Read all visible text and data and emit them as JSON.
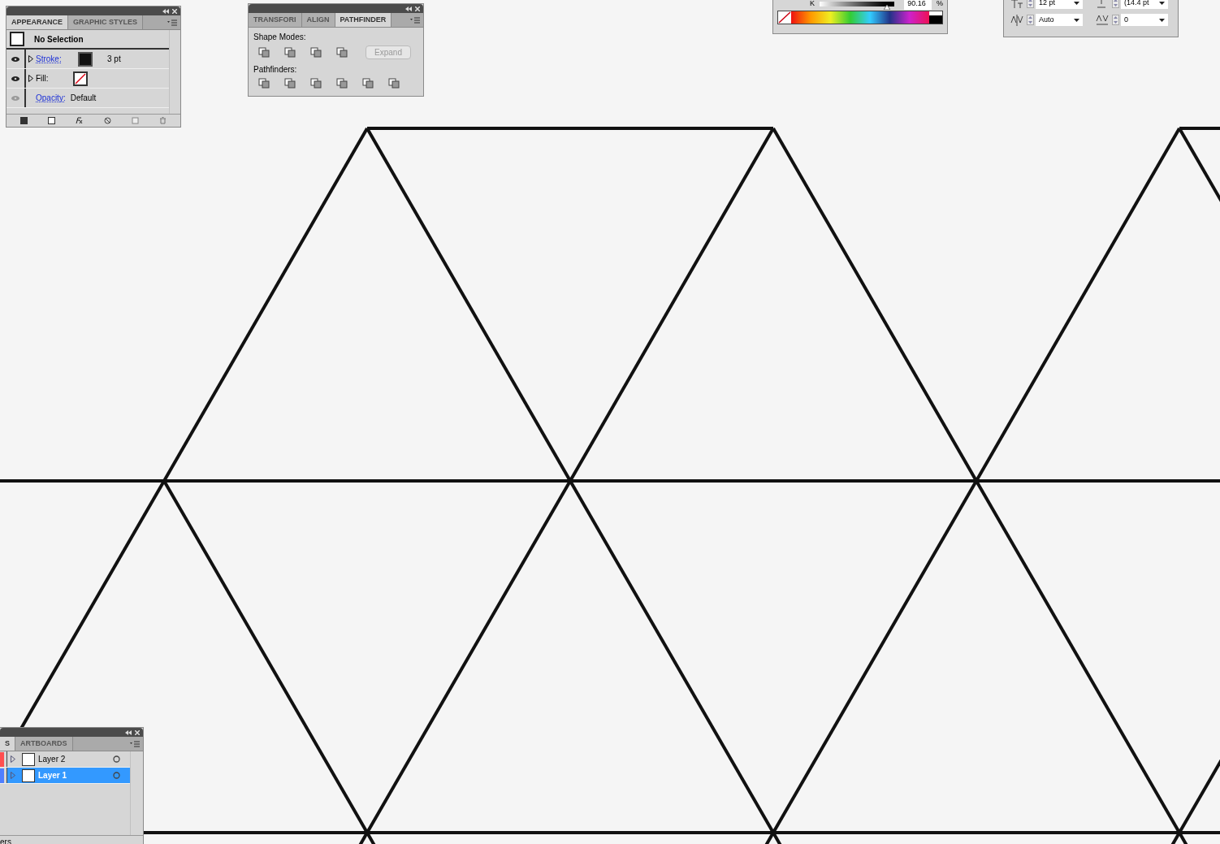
{
  "appearance_panel": {
    "tabs": [
      {
        "label": "APPEARANCE",
        "selected": true
      },
      {
        "label": "GRAPHIC STYLES",
        "selected": false
      }
    ],
    "header": "No Selection",
    "rows": [
      {
        "kind": "stroke",
        "label": "Stroke:",
        "value": "3 pt",
        "visible": true
      },
      {
        "kind": "fill",
        "label": "Fill:",
        "visible": true
      },
      {
        "kind": "opacity",
        "label": "Opacity:",
        "value": "Default",
        "visible": false
      }
    ]
  },
  "pathfinder_panel": {
    "tabs": [
      {
        "label": "TRANSFORI",
        "selected": false
      },
      {
        "label": "ALIGN",
        "selected": false
      },
      {
        "label": "PATHFINDER",
        "selected": true
      }
    ],
    "shape_modes_label": "Shape Modes:",
    "expand_button": {
      "label": "Expand",
      "disabled": true
    },
    "pathfinders_label": "Pathfinders:"
  },
  "color_panel": {
    "channel": "K",
    "value": "90.16",
    "unit": "%",
    "level": 0.9
  },
  "character_panel": {
    "font_size": "12 pt",
    "leading": "(14.4 pt",
    "kerning": "Auto",
    "tracking": "0"
  },
  "layers_panel": {
    "tabs": [
      {
        "label": "S",
        "selected": true
      },
      {
        "label": "ARTBOARDS",
        "selected": false
      }
    ],
    "layers": [
      {
        "name": "Layer 2",
        "color": "#ff4f4f",
        "selected": false
      },
      {
        "name": "Layer 1",
        "color": "#4f7fff",
        "selected": true
      }
    ],
    "footer": "ers"
  }
}
